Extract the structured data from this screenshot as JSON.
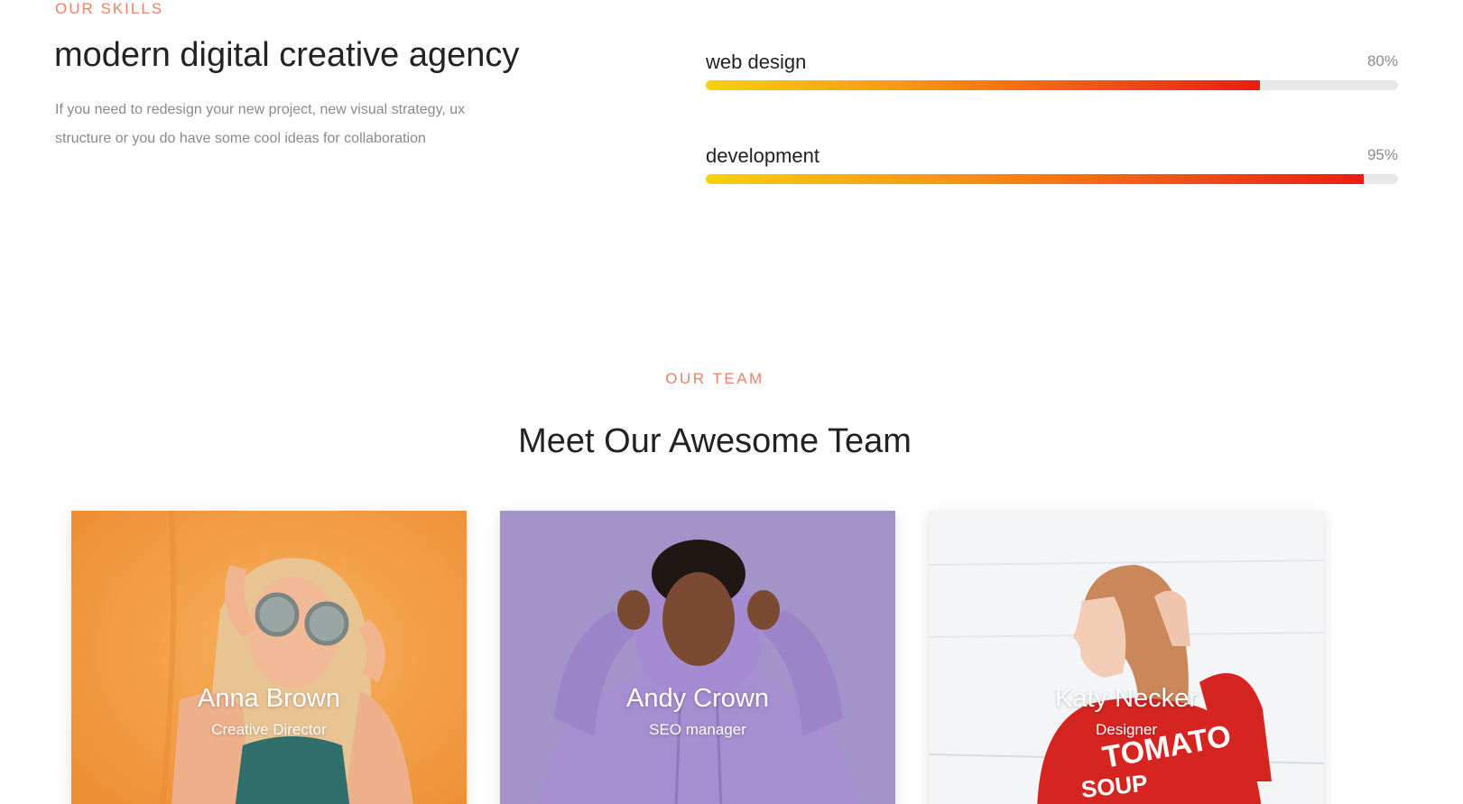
{
  "skills": {
    "eyebrow": "OUR SKILLS",
    "title": "modern digital creative agency",
    "description": "If you need to redesign your new project, new visual strategy, ux structure or you do have some cool ideas for collaboration",
    "items": [
      {
        "label": "web design",
        "percent_text": "80%",
        "value": 0.8
      },
      {
        "label": "development",
        "percent_text": "95%",
        "value": 0.95
      }
    ],
    "bar_gradient": [
      "#f7d20a",
      "#f59a12",
      "#f24a1a",
      "#ef1b12"
    ],
    "track_color": "#e8e8e8"
  },
  "team": {
    "eyebrow": "OUR TEAM",
    "title": "Meet Our Awesome Team",
    "members": [
      {
        "name": "Anna Brown",
        "role": "Creative Director",
        "bg": "#f39a3c"
      },
      {
        "name": "Andy Crown",
        "role": "SEO manager",
        "bg": "#9f8fc5"
      },
      {
        "name": "Katy Necker",
        "role": "Designer",
        "bg": "#f2f4f6",
        "shirt_text_line1": "TOMATO",
        "shirt_text_line2": "SOUP"
      }
    ]
  },
  "colors": {
    "accent": "#e8826a",
    "heading": "#222222",
    "muted": "#8a8a8a"
  }
}
